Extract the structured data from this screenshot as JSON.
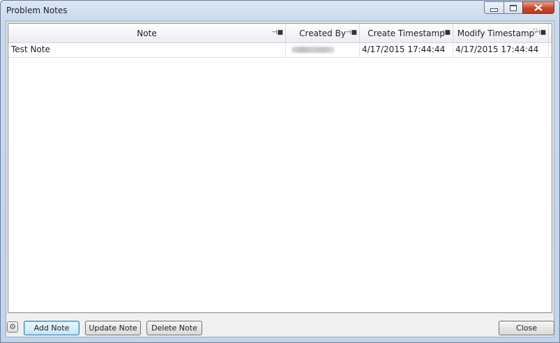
{
  "window": {
    "title": "Problem Notes",
    "controls": {
      "minimize_icon": "minimize-icon",
      "maximize_icon": "maximize-icon",
      "close_icon": "close-icon"
    }
  },
  "grid": {
    "columns": [
      {
        "label": "Note",
        "pin_icon": "pin-icon"
      },
      {
        "label": "Created By",
        "pin_icon": "pin-icon"
      },
      {
        "label": "Create Timestamp",
        "pin_icon": "pin-icon"
      },
      {
        "label": "Modify Timestamp",
        "pin_icon": "pin-icon",
        "sort_icon": "sort-descending-icon"
      }
    ],
    "rows": [
      {
        "note": "Test Note",
        "created_by": "",
        "create_timestamp": "4/17/2015 17:44:44",
        "modify_timestamp": "4/17/2015 17:44:44"
      }
    ]
  },
  "footer": {
    "settings_icon": "settings-icon",
    "add_label": "Add Note",
    "update_label": "Update Note",
    "delete_label": "Delete Note",
    "close_label": "Close"
  },
  "colors": {
    "title_bar": "#c9d9ee",
    "close_button": "#c8462c",
    "default_button_border": "#3c7fb1"
  }
}
